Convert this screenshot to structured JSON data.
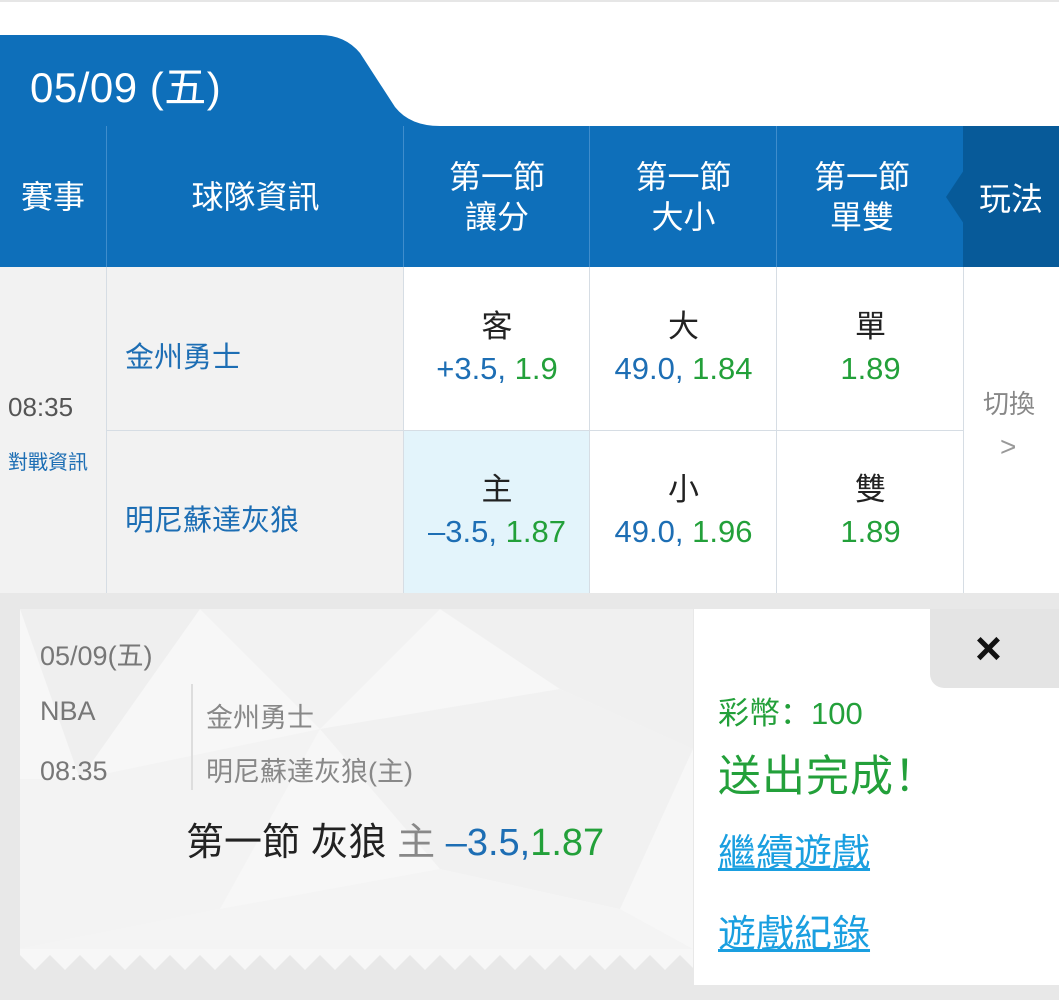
{
  "date_tab": "05/09 (五)",
  "header": {
    "event": "賽事",
    "team_info": "球隊資訊",
    "spread": [
      "第一節",
      "讓分"
    ],
    "total": [
      "第一節",
      "大小"
    ],
    "oddeven": [
      "第一節",
      "單雙"
    ],
    "play": "玩法"
  },
  "match": {
    "time": "08:35",
    "info_link": "對戰資訊",
    "away_team": "金州勇士",
    "home_team": "明尼蘇達灰狼",
    "away": {
      "spread_sel": "客",
      "spread_line": "+3.5,",
      "spread_odds": "1.9",
      "total_sel": "大",
      "total_line": "49.0,",
      "total_odds": "1.84",
      "oe_sel": "單",
      "oe_odds": "1.89"
    },
    "home": {
      "spread_sel": "主",
      "spread_line": "–3.5,",
      "spread_odds": "1.87",
      "total_sel": "小",
      "total_line": "49.0,",
      "total_odds": "1.96",
      "oe_sel": "雙",
      "oe_odds": "1.89"
    },
    "switch_label": "切換",
    "switch_arrow": ">"
  },
  "slip": {
    "date": "05/09(五)",
    "league": "NBA",
    "time": "08:35",
    "away": "金州勇士",
    "home": "明尼蘇達灰狼(主)",
    "bet_period": "第一節 灰狼",
    "bet_side": "主",
    "bet_line": "–3.5,",
    "bet_odds": "1.87",
    "close": "×",
    "coins": "彩幣：100",
    "done": "送出完成！",
    "continue_link": "繼續遊戲",
    "history_link": "遊戲紀錄"
  },
  "colors": {
    "primary": "#0e6fba",
    "primary_dark": "#075a99",
    "team_blue": "#1d6eb4",
    "odds_green": "#23a03a",
    "link_blue": "#1a9fe0",
    "selected_bg": "#e3f4fb"
  }
}
